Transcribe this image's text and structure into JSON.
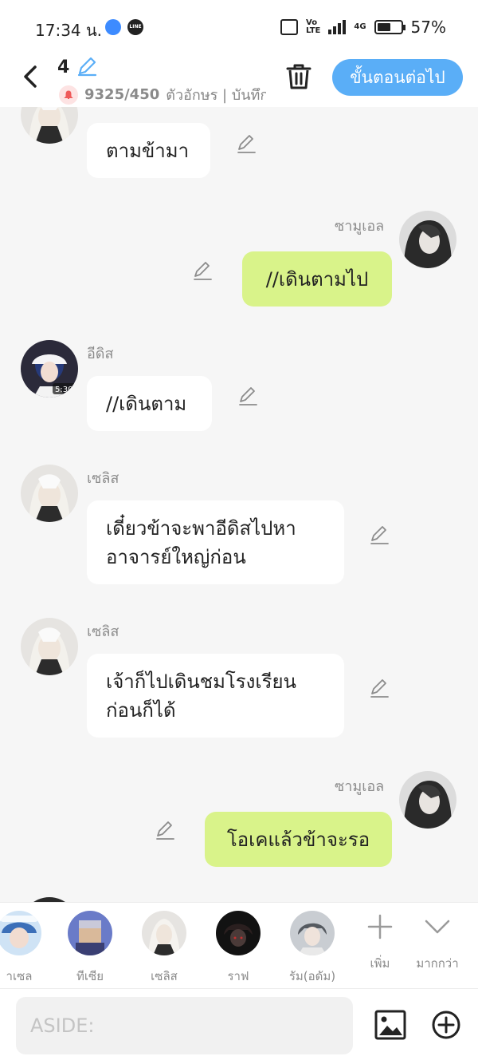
{
  "status": {
    "time": "17:34 น.",
    "network": "4G",
    "battery": "57%",
    "battery_level": 0.57,
    "icons": [
      "app-icon",
      "line-app-icon",
      "vibrate-icon",
      "volte-icon",
      "signal-icon",
      "battery-icon"
    ]
  },
  "header": {
    "episode": "4",
    "char_count": "9325/450",
    "char_info": "ตัวอักษร | บันทึก",
    "next_button": "ขั้นตอนต่อไป",
    "accent": "#5aaef7"
  },
  "messages": [
    {
      "side": "left",
      "name": "",
      "text": "ตามข้ามา"
    },
    {
      "side": "right",
      "name": "ซามูเอล",
      "text": "//เดินตามไป"
    },
    {
      "side": "left",
      "name": "อีดิส",
      "text": "//เดินตาม",
      "avatar_badge": "5:30"
    },
    {
      "side": "left",
      "name": "เซลิส",
      "text": "เดี๋ยวข้าจะพาอีดิสไปหาอาจารย์ใหญ่ก่อน"
    },
    {
      "side": "left",
      "name": "เซลิส",
      "text": "เจ้าก็ไปเดินชมโรงเรียนก่อนก็ได้"
    },
    {
      "side": "right",
      "name": "ซามูเอล",
      "text": "โอเคแล้วข้าจะรอ"
    }
  ],
  "characters": [
    {
      "name": "าเซล"
    },
    {
      "name": "ทีเซีย"
    },
    {
      "name": "เซลิส"
    },
    {
      "name": "ราฟ"
    },
    {
      "name": "รัม(อดัม)"
    }
  ],
  "tools": {
    "add_label": "เพิ่ม",
    "more_label": "มากกว่า"
  },
  "input": {
    "placeholder": "ASIDE:"
  },
  "colors": {
    "right_bubble": "#d9f38a",
    "left_bubble": "#ffffff",
    "background": "#f6f6f6"
  }
}
